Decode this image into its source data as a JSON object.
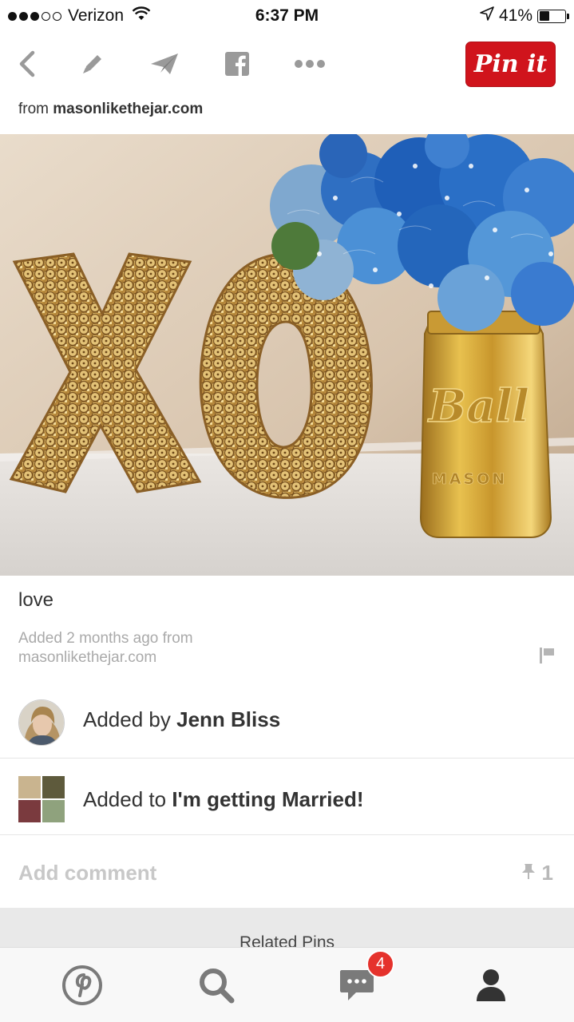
{
  "status_bar": {
    "carrier": "Verizon",
    "time": "6:37 PM",
    "battery": "41%",
    "battery_level": 0.41,
    "signal_bars_filled": 3,
    "signal_bars_total": 5
  },
  "toolbar": {
    "icons": [
      "back-icon",
      "edit-icon",
      "send-icon",
      "facebook-icon",
      "more-icon"
    ],
    "pin_button": "Pin it"
  },
  "source": {
    "prefix": "from",
    "domain": "masonlikethejar.com"
  },
  "pin": {
    "image_alt": "Gold sequin XO letters next to a gold Ball mason jar with blue hydrangeas",
    "jar_text": "Ball",
    "jar_subtext": "MASON",
    "description": "love",
    "added_line_1": "Added 2 months ago from",
    "added_line_2": "masonlikethejar.com"
  },
  "added_by": {
    "prefix": "Added by",
    "name": "Jenn Bliss"
  },
  "added_to": {
    "prefix": "Added to",
    "board": "I'm getting Married!"
  },
  "comment": {
    "placeholder": "Add comment",
    "repin_count": "1"
  },
  "related": {
    "title": "Related Pins"
  },
  "tabbar": {
    "tabs": [
      "pinterest-home",
      "search",
      "messages",
      "profile"
    ],
    "messages_badge": "4"
  },
  "colors": {
    "brand_red": "#d0141c",
    "badge_red": "#e5322c",
    "muted_text": "#aaaaaa"
  }
}
